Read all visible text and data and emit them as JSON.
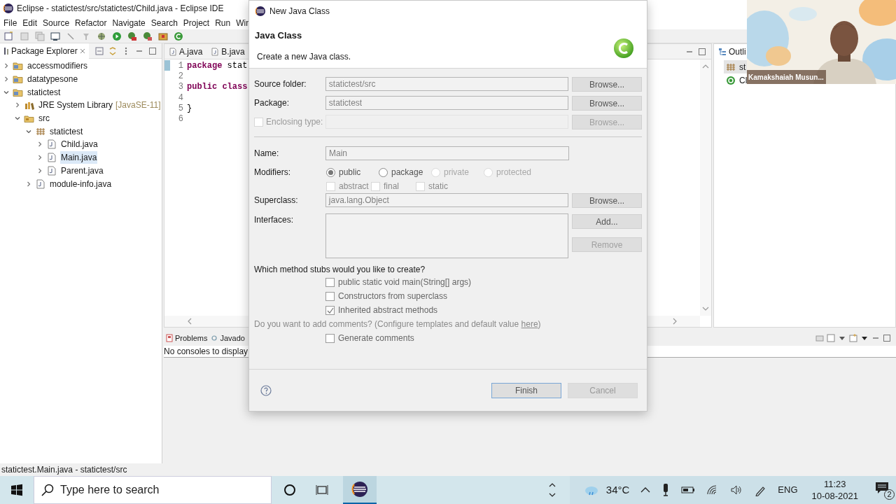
{
  "window": {
    "title": "Eclipse - statictest/src/statictest/Child.java - Eclipse IDE"
  },
  "menu": [
    "File",
    "Edit",
    "Source",
    "Refactor",
    "Navigate",
    "Search",
    "Project",
    "Run",
    "Win"
  ],
  "package_explorer": {
    "title": "Package Explorer",
    "tree": [
      {
        "label": "accessmodifiers",
        "kind": "project",
        "expanded": false,
        "selected": false
      },
      {
        "label": "datatypesone",
        "kind": "project",
        "expanded": false,
        "selected": false
      },
      {
        "label": "statictest",
        "kind": "project",
        "expanded": true,
        "selected": false,
        "children": [
          {
            "label": "JRE System Library",
            "decoration": "[JavaSE-11]",
            "kind": "library",
            "expanded": false,
            "selected": false
          },
          {
            "label": "src",
            "kind": "folder",
            "expanded": true,
            "selected": false,
            "children": [
              {
                "label": "statictest",
                "kind": "package",
                "expanded": true,
                "selected": false,
                "children": [
                  {
                    "label": "Child.java",
                    "kind": "file",
                    "expanded": false,
                    "selected": false
                  },
                  {
                    "label": "Main.java",
                    "kind": "file",
                    "expanded": false,
                    "selected": true
                  },
                  {
                    "label": "Parent.java",
                    "kind": "file",
                    "expanded": false,
                    "selected": false
                  }
                ]
              },
              {
                "label": "module-info.java",
                "kind": "file",
                "expanded": false,
                "selected": false
              }
            ]
          }
        ]
      }
    ]
  },
  "editor": {
    "tabs": [
      {
        "label": "A.java",
        "selected": false
      },
      {
        "label": "B.java",
        "selected": false
      }
    ],
    "lines": [
      {
        "number": "1",
        "marker": true,
        "tokens": [
          {
            "text": "package",
            "kind": "keyword"
          },
          {
            "text": " stat",
            "kind": "plain"
          }
        ]
      },
      {
        "number": "2",
        "marker": false
      },
      {
        "number": "3",
        "marker": false,
        "tokens": [
          {
            "text": "public class",
            "kind": "keyword"
          }
        ]
      },
      {
        "number": "4",
        "marker": false
      },
      {
        "number": "5",
        "marker": false,
        "tokens": [
          {
            "text": "}",
            "kind": "plain"
          }
        ]
      },
      {
        "number": "6",
        "marker": false
      }
    ]
  },
  "outline": {
    "title": "Outli",
    "items": [
      {
        "label": "st",
        "kind": "package",
        "selected": true
      },
      {
        "label": "Cl",
        "kind": "class",
        "selected": false
      }
    ]
  },
  "bottom_panel": {
    "tabs": [
      {
        "label": "Problems",
        "kind": "problems"
      },
      {
        "label": "Javado",
        "kind": "javadoc"
      }
    ],
    "message": "No consoles to display"
  },
  "status_bar": "statictest.Main.java - statictest/src",
  "dialog": {
    "title": "New Java Class",
    "heading": "Java Class",
    "description": "Create a new Java class.",
    "rows": [
      {
        "kind": "field",
        "label": "Source folder:",
        "value": "statictest/src",
        "button": "Browse...",
        "button_disabled": false
      },
      {
        "kind": "field",
        "label": "Package:",
        "value": "statictest",
        "button": "Browse...",
        "button_disabled": false
      },
      {
        "kind": "check_field",
        "label": "Enclosing type:",
        "checked": false,
        "disabled": true,
        "button": "Browse...",
        "button_disabled": true
      },
      {
        "kind": "separator"
      },
      {
        "kind": "field",
        "label": "Name:",
        "value": "Main"
      },
      {
        "kind": "radios",
        "label": "Modifiers:",
        "options": [
          {
            "label": "public",
            "selected": true,
            "disabled": false
          },
          {
            "label": "package",
            "selected": false,
            "disabled": false
          },
          {
            "label": "private",
            "selected": false,
            "disabled": true
          },
          {
            "label": "protected",
            "selected": false,
            "disabled": true
          }
        ]
      },
      {
        "kind": "checks",
        "options": [
          {
            "label": "abstract",
            "checked": false
          },
          {
            "label": "final",
            "checked": false
          },
          {
            "label": "static",
            "checked": false
          }
        ]
      },
      {
        "kind": "field",
        "label": "Superclass:",
        "value": "java.lang.Object",
        "button": "Browse...",
        "button_disabled": false
      },
      {
        "kind": "list",
        "label": "Interfaces:",
        "buttons": [
          {
            "label": "Add...",
            "disabled": false
          },
          {
            "label": "Remove",
            "disabled": true
          }
        ]
      }
    ],
    "stubs": {
      "question": "Which method stubs would you like to create?",
      "options": [
        {
          "label": "public static void main(String[] args)",
          "checked": false
        },
        {
          "label": "Constructors from superclass",
          "checked": false
        },
        {
          "label": "Inherited abstract methods",
          "checked": true
        }
      ]
    },
    "comments": {
      "prompt": "Do you want to add comments? (Configure templates and default value ",
      "link": "here",
      "prompt_end": ")",
      "option": {
        "label": "Generate comments",
        "checked": false
      }
    },
    "buttons": [
      {
        "label": "Finish",
        "default": true,
        "disabled": false
      },
      {
        "label": "Cancel",
        "default": false,
        "disabled": true
      }
    ]
  },
  "webcam": {
    "caption": "Kamakshaiah Musun..."
  },
  "taskbar": {
    "search_placeholder": "Type here to search",
    "temperature": "34°C",
    "language": "ENG",
    "time": "11:23",
    "date": "10-08-2021",
    "notifications": "2"
  }
}
